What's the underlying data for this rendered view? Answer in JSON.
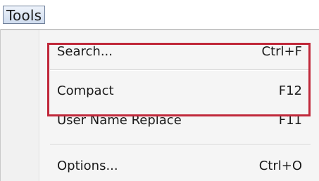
{
  "menubar": {
    "title": "Tools"
  },
  "menu": {
    "items": [
      {
        "label": "Search...",
        "shortcut": "Ctrl+F"
      },
      {
        "label": "Compact",
        "shortcut": "F12"
      },
      {
        "label": "User Name Replace",
        "shortcut": "F11"
      },
      {
        "label": "Options...",
        "shortcut": "Ctrl+O"
      }
    ]
  },
  "annotation": {
    "highlight_color": "#c0283a",
    "highlighted_items": [
      "Compact",
      "User Name Replace"
    ]
  }
}
